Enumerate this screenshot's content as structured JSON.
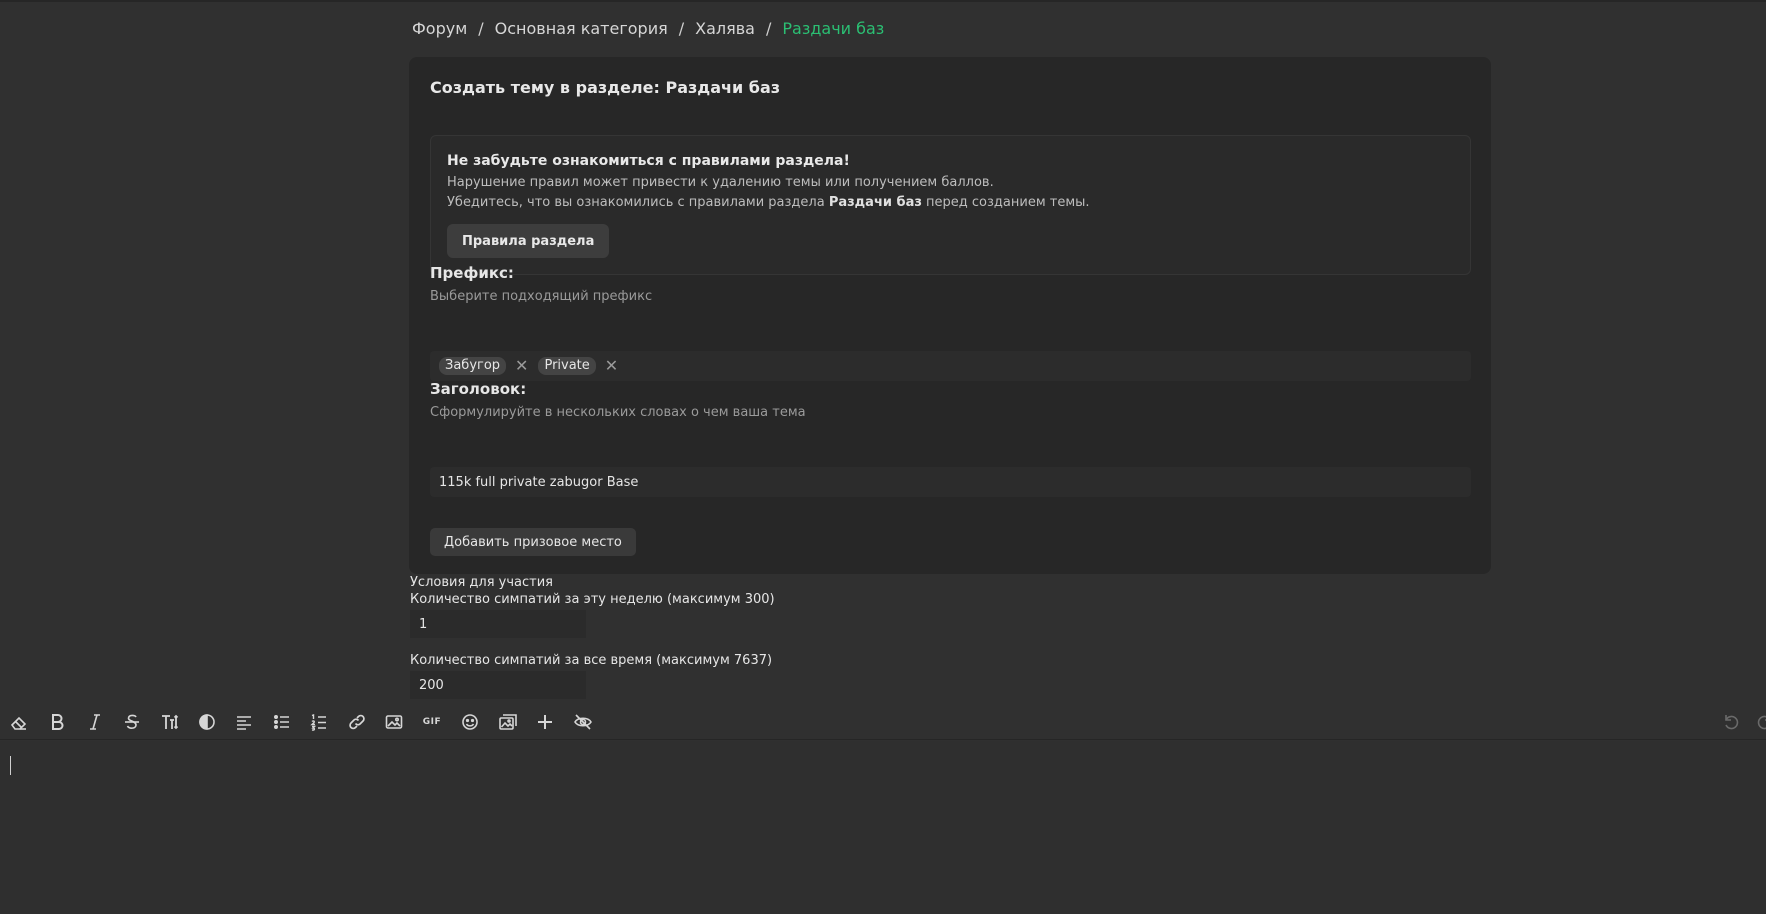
{
  "breadcrumb": {
    "items": [
      "Форум",
      "Основная категория",
      "Халява"
    ],
    "current": "Раздачи баз",
    "separator": "/"
  },
  "form": {
    "title": "Создать тему в разделе: Раздачи баз",
    "notice": {
      "title": "Не забудьте ознакомиться с правилами раздела!",
      "line1": "Нарушение правил может привести к удалению темы или получением баллов.",
      "line2_before": "Убедитесь, что вы ознакомились с правилами раздела ",
      "line2_bold": "Раздачи баз",
      "line2_after": " перед созданием темы.",
      "rules_button": "Правила раздела"
    },
    "prefix": {
      "label": "Префикс:",
      "hint": "Выберите подходящий префикс",
      "tags": [
        "Забугор",
        "Private"
      ]
    },
    "heading": {
      "label": "Заголовок:",
      "hint": "Сформулируйте в нескольких словах о чем ваша тема",
      "value": "115k full private zabugor Base"
    },
    "add_prize_button": "Добавить призовое место"
  },
  "conditions": {
    "title": "Условия для участия",
    "week_label": "Количество симпатий за эту неделю (максимум 300)",
    "week_value": "1",
    "all_label": "Количество симпатий за все время (максимум 7637)",
    "all_value": "200"
  },
  "toolbar": {
    "icons": [
      "eraser-icon",
      "bold-icon",
      "italic-icon",
      "strikethrough-icon",
      "text-size-icon",
      "color-icon",
      "align-icon",
      "bullet-list-icon",
      "numbered-list-icon",
      "link-icon",
      "image-icon",
      "gif-icon",
      "emoji-icon",
      "gallery-icon",
      "plus-icon",
      "hide-icon",
      "undo-icon",
      "redo-icon"
    ],
    "gif_label": "GIF"
  },
  "colors": {
    "accent": "#2bbf73",
    "background": "#303030",
    "card": "#272727"
  }
}
